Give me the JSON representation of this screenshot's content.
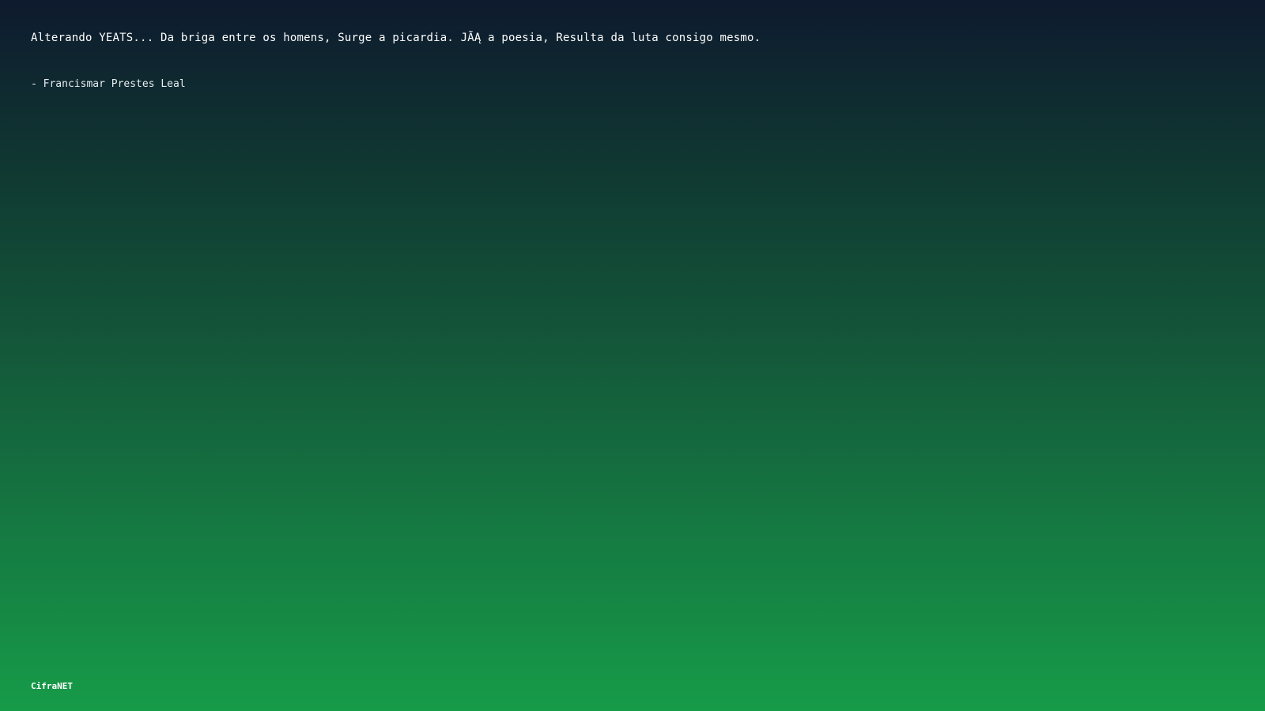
{
  "quote": {
    "text": "Alterando YEATS... Da briga entre os homens, Surge a picardia. JÃĄ a poesia, Resulta da luta consigo mesmo.",
    "author": "- Francismar Prestes Leal"
  },
  "footer": {
    "brand": "CifraNET"
  },
  "colors": {
    "gradient_top": "#0e1a2e",
    "gradient_bottom": "#169b48",
    "text": "#ffffff"
  }
}
